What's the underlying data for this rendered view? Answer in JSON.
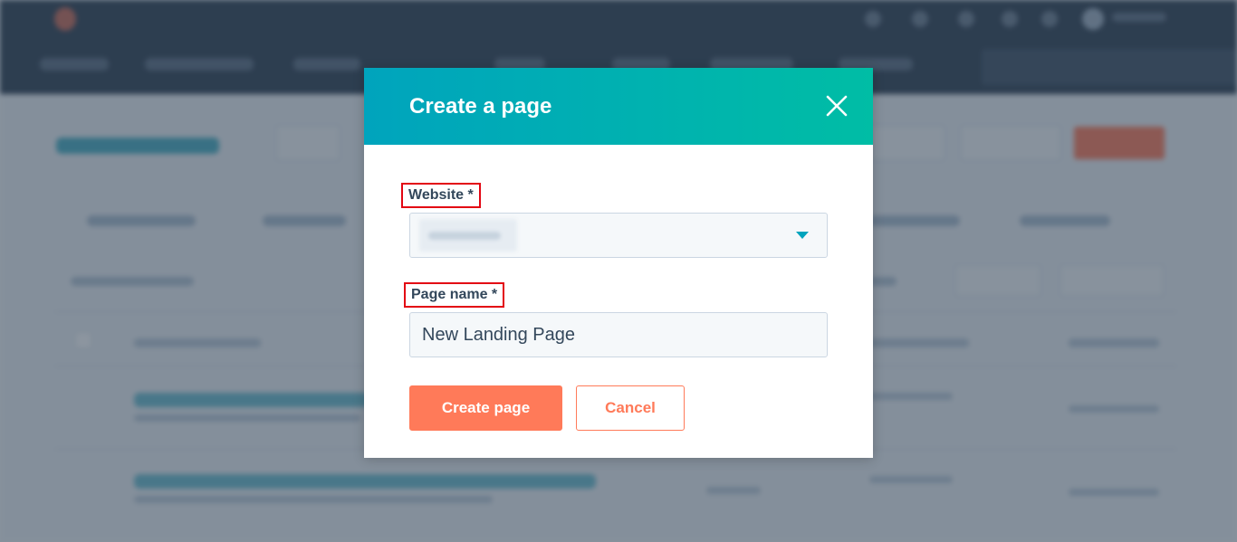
{
  "modal": {
    "title": "Create a page",
    "website_label": "Website *",
    "website_value": "",
    "page_name_label": "Page name *",
    "page_name_value": "New Landing Page",
    "create_button": "Create page",
    "cancel_button": "Cancel"
  },
  "colors": {
    "header_gradient_start": "#00a4bd",
    "header_gradient_end": "#00bda5",
    "primary_button": "#ff7a59",
    "label_highlight_border": "#e30613"
  },
  "icons": {
    "close": "close-icon",
    "dropdown": "caret-down-icon"
  }
}
